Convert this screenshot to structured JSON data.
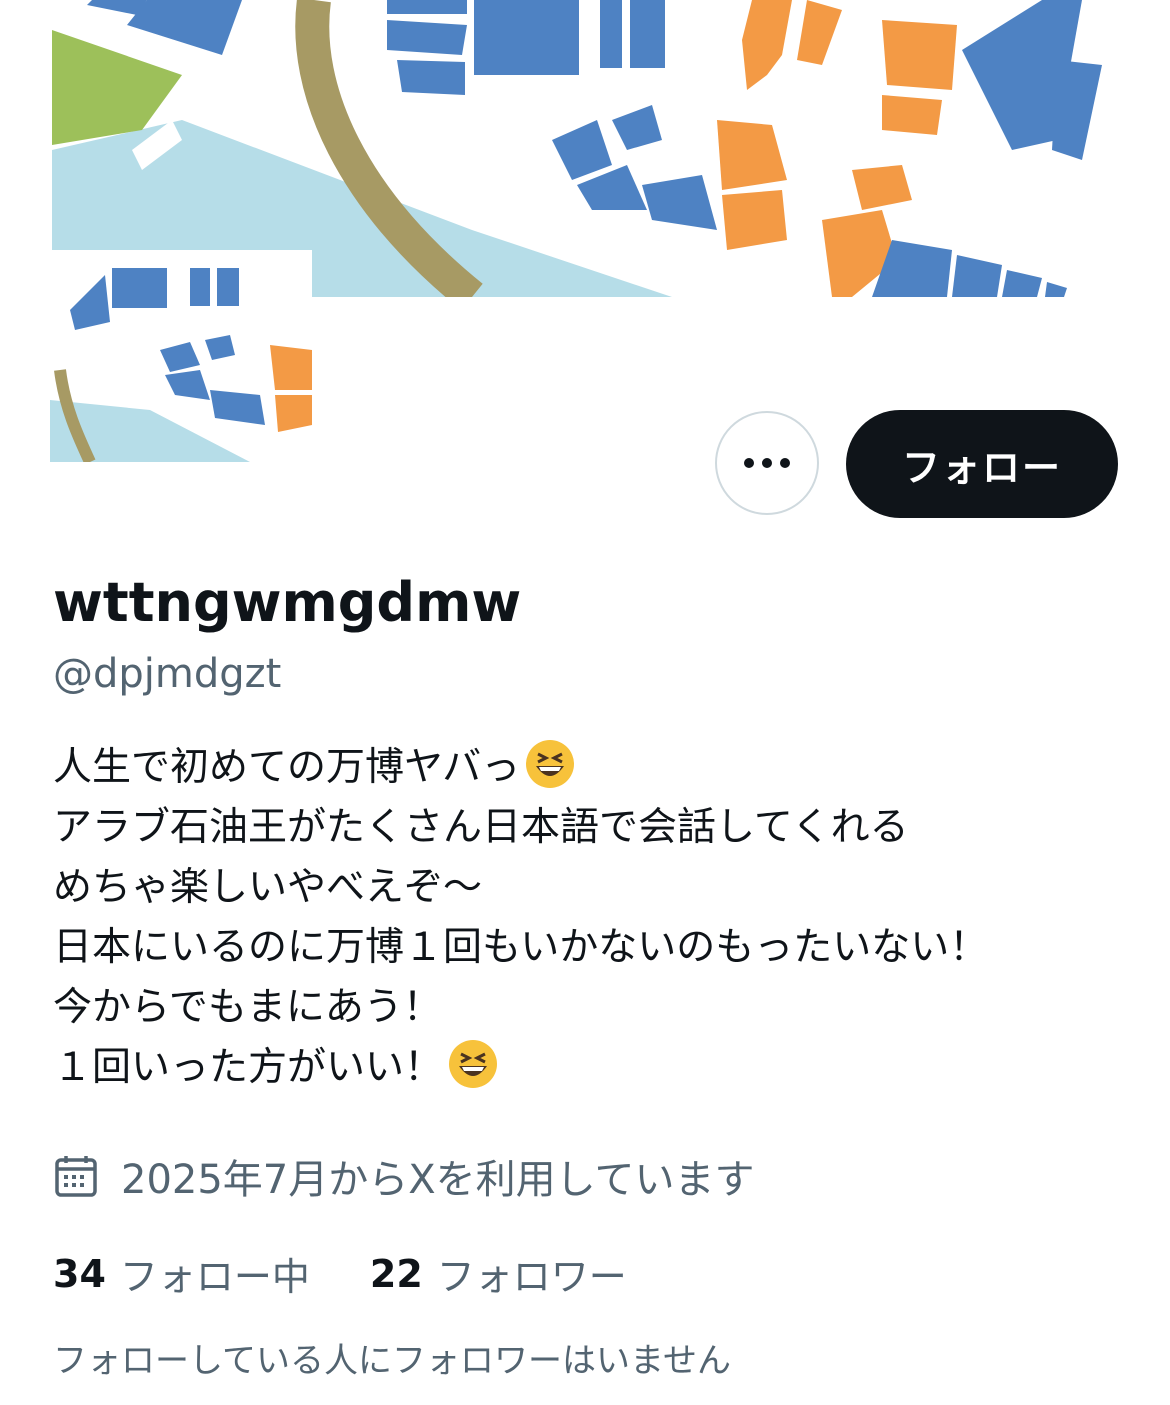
{
  "profile": {
    "display_name": "wttngwmgdmw",
    "handle": "@dpjmdgzt",
    "bio_lines": [
      "人生で初めての万博ヤバっ",
      "アラブ石油王がたくさん日本語で会話してくれる",
      "めちゃ楽しいやべえぞ〜",
      "日本にいるのに万博１回もいかないのもったいない！",
      "今からでもまにあう！",
      "１回いった方がいい！"
    ],
    "bio_emoji": "grinning-squinting-face",
    "joined": "2025年7月からXを利用しています",
    "following_count": "34",
    "following_label": "フォロー中",
    "followers_count": "22",
    "followers_label": "フォロワー",
    "followers_you_know_note": "フォローしている人にフォロワーはいません"
  },
  "actions": {
    "follow_label": "フォロー",
    "more_icon": "more-horizontal-icon"
  },
  "icons": {
    "joined": "calendar-icon"
  },
  "colors": {
    "primary_text": "#0f1419",
    "secondary_text": "#536471",
    "follow_button_bg": "#0f1419",
    "banner_blue": "#4e82c3",
    "banner_orange": "#f39a45",
    "banner_green": "#9dc05a",
    "banner_path": "#a79a64",
    "banner_water": "#b6dde8"
  }
}
